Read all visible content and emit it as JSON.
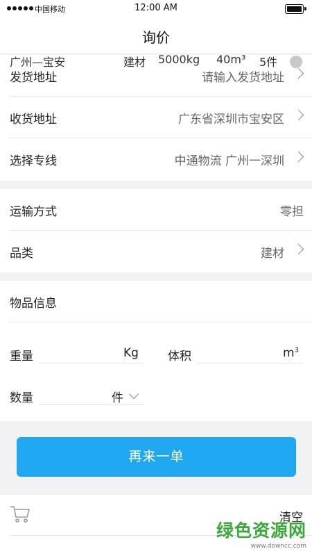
{
  "status_bar": {
    "carrier": "中国移动",
    "time": "12:00 AM"
  },
  "nav": {
    "title": "询价"
  },
  "address": {
    "rows": [
      {
        "label": "发货地址",
        "value": "请输入发货地址"
      },
      {
        "label": "收货地址",
        "value": "广东省深圳市宝安区"
      },
      {
        "label": "选择专线",
        "value": "中通物流  广州一深圳"
      }
    ]
  },
  "transport": {
    "method_label": "运输方式",
    "method_value": "零担",
    "category_label": "品类",
    "category_value": "建材"
  },
  "goods": {
    "title": "物品信息",
    "weight_label": "重量",
    "weight_unit": "Kg",
    "volume_label": "体积",
    "volume_unit": "m",
    "volume_unit_sup": "3",
    "quantity_label": "数量",
    "quantity_unit": "件"
  },
  "actions": {
    "reorder_label": "再来一单"
  },
  "cart": {
    "clear_label": "清空",
    "order": {
      "route": "广州—宝安",
      "category": "建材",
      "weight": "5000kg",
      "volume": "40m³",
      "count": "5件"
    }
  },
  "watermark": {
    "main": "绿色资源网",
    "sub": "www.downcc.com"
  },
  "colors": {
    "primary_button": "#1fa7f2",
    "watermark_green": "#3aa83a"
  }
}
